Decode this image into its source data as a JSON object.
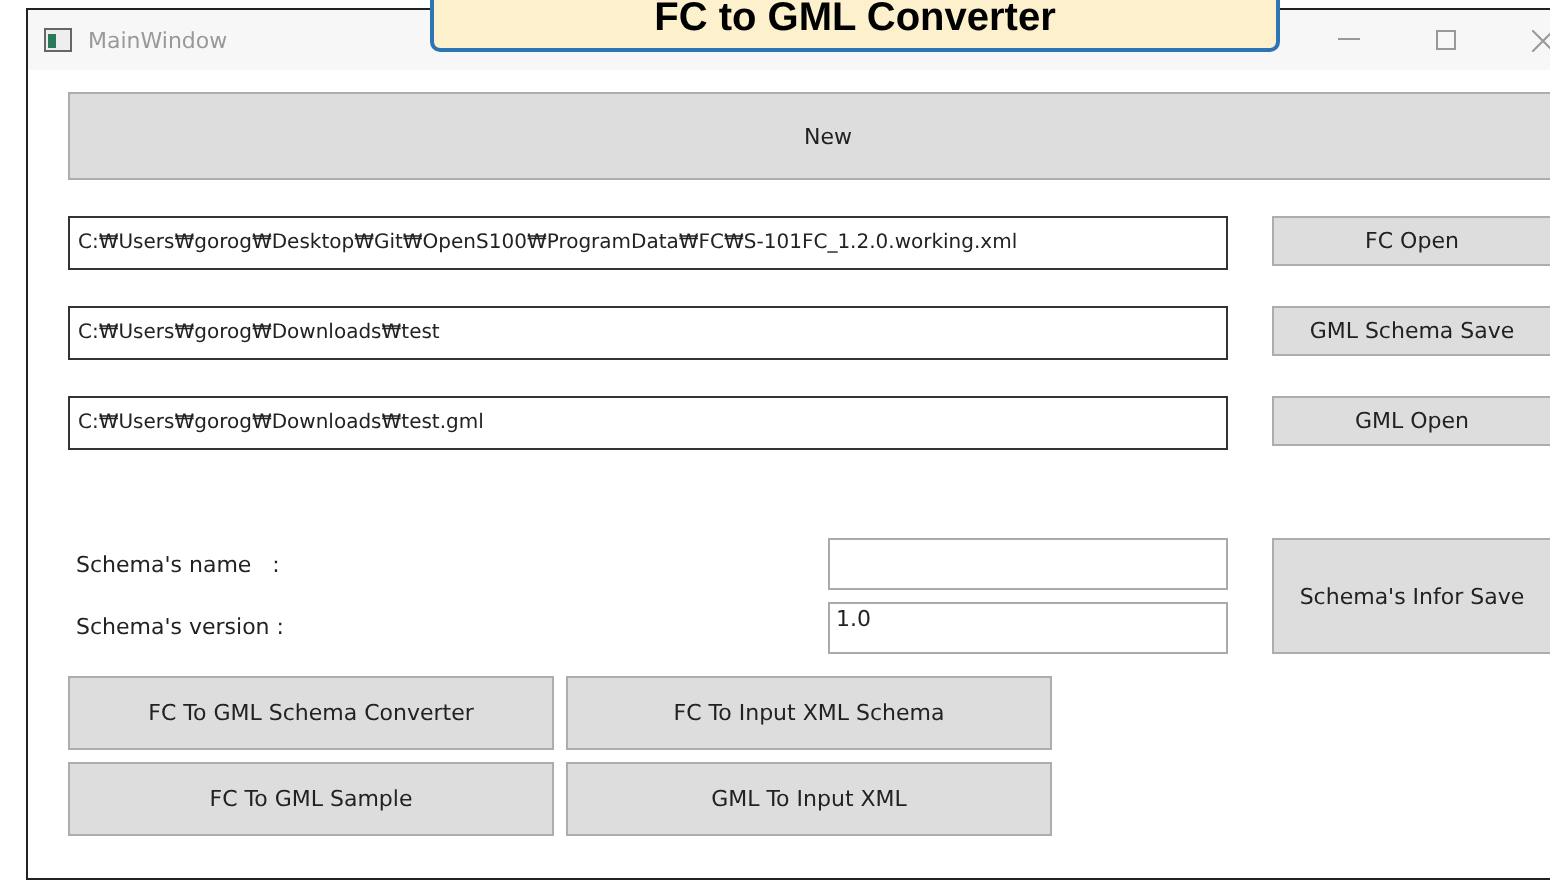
{
  "banner": {
    "title": "FC to GML Converter"
  },
  "window": {
    "title": "MainWindow"
  },
  "new_button": "New",
  "file_rows": [
    {
      "path": "C:₩Users₩gorog₩Desktop₩Git₩OpenS100₩ProgramData₩FC₩S-101FC_1.2.0.working.xml",
      "button": "FC Open"
    },
    {
      "path": "C:₩Users₩gorog₩Downloads₩test",
      "button": "GML Schema Save"
    },
    {
      "path": "C:₩Users₩gorog₩Downloads₩test.gml",
      "button": "GML Open"
    }
  ],
  "schema_fields": [
    {
      "label": "Schema's name   :"
    },
    {
      "label": "Schema's version :",
      "value": "1.0"
    }
  ],
  "schema_save_button": "Schema's Infor Save",
  "convert_buttons": [
    "FC To GML Schema Converter",
    "FC To Input XML Schema",
    "FC To GML Sample",
    "GML To Input XML"
  ]
}
